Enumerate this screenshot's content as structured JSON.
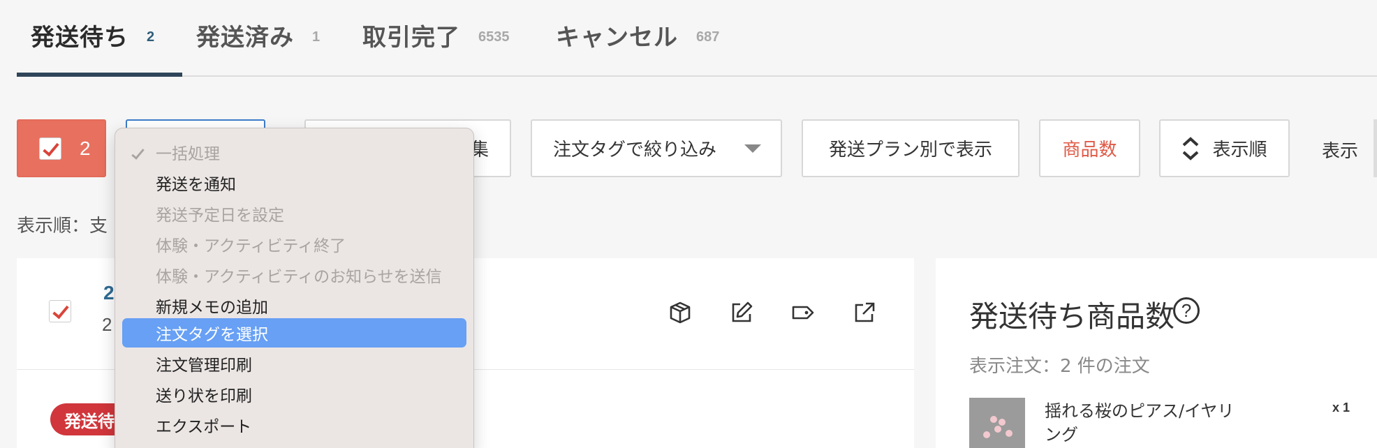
{
  "tabs": [
    {
      "label": "発送待ち",
      "count": "2"
    },
    {
      "label": "発送済み",
      "count": "1"
    },
    {
      "label": "取引完了",
      "count": "6535"
    },
    {
      "label": "キャンセル",
      "count": "687"
    }
  ],
  "toolbar": {
    "select_count": "2",
    "memo_fragment": "集",
    "tag_filter": "注文タグで絞り込み",
    "shipping_plan": "発送プラン別で表示",
    "item_count": "商品数",
    "sort_order": "表示順",
    "display": "表示"
  },
  "sort_info": "表示順：支",
  "dropdown": {
    "header": "一括処理",
    "items": [
      {
        "label": "発送を通知",
        "state": "enabled"
      },
      {
        "label": "発送予定日を設定",
        "state": "disabled"
      },
      {
        "label": "体験・アクティビティ終了",
        "state": "disabled"
      },
      {
        "label": "体験・アクティビティのお知らせを送信",
        "state": "disabled"
      },
      {
        "label": "新規メモの追加",
        "state": "enabled"
      },
      {
        "label": "注文タグを選択",
        "state": "selected"
      },
      {
        "label": "注文管理印刷",
        "state": "enabled"
      },
      {
        "label": "送り状を印刷",
        "state": "enabled"
      },
      {
        "label": "エクスポート",
        "state": "enabled"
      }
    ]
  },
  "order": {
    "number_fragment": "2",
    "date_fragment": "2",
    "status": "発送待ち",
    "icons": [
      "package-icon",
      "edit-icon",
      "tag-icon",
      "external-link-icon"
    ]
  },
  "panel": {
    "title": "発送待ち商品数",
    "help": "?",
    "subtitle": "表示注文：2 件の注文",
    "product_name": "揺れる桜のピアス/イヤリング",
    "product_qty": "x 1"
  },
  "colors": {
    "accent_red": "#e8705f",
    "status_red": "#d0363b",
    "selection_blue": "#67a0f4",
    "tab_underline": "#2f4559"
  }
}
